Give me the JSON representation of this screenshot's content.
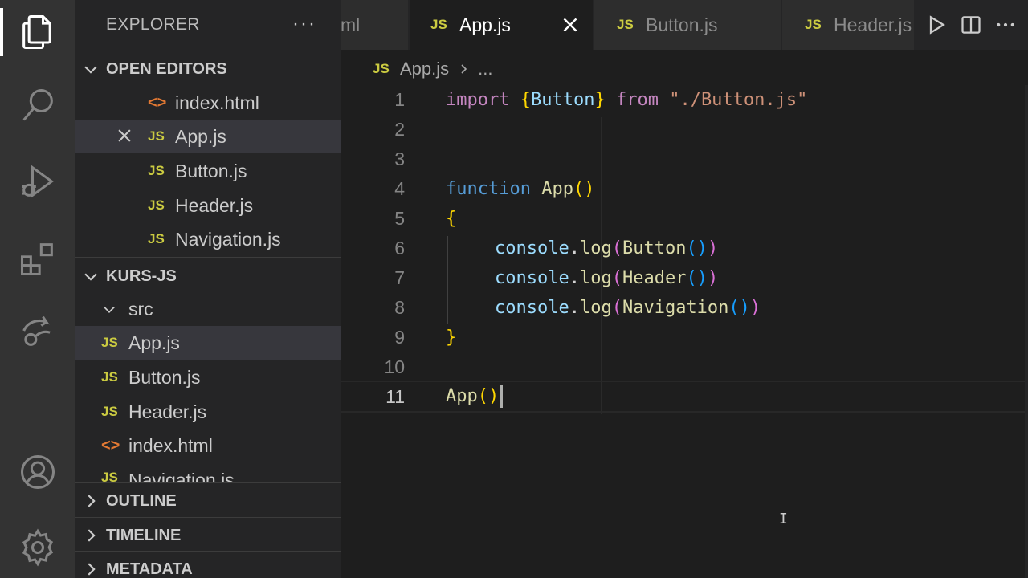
{
  "activity_bar": {
    "items": [
      {
        "name": "explorer",
        "icon": "files-icon"
      },
      {
        "name": "search",
        "icon": "search-icon"
      },
      {
        "name": "run-debug",
        "icon": "debug-icon"
      },
      {
        "name": "extensions",
        "icon": "extensions-icon"
      },
      {
        "name": "remote-explorer",
        "icon": "remote-icon"
      },
      {
        "name": "accounts",
        "icon": "account-icon"
      },
      {
        "name": "manage",
        "icon": "gear-icon"
      }
    ]
  },
  "sidebar": {
    "title": "EXPLORER",
    "more": "···",
    "open_editors": {
      "label": "OPEN EDITORS",
      "items": [
        {
          "badge": "<>",
          "name": "index.html"
        },
        {
          "badge": "JS",
          "name": "App.js"
        },
        {
          "badge": "JS",
          "name": "Button.js"
        },
        {
          "badge": "JS",
          "name": "Header.js"
        },
        {
          "badge": "JS",
          "name": "Navigation.js"
        }
      ]
    },
    "project": {
      "label": "KURS-JS",
      "folder": "src",
      "items": [
        {
          "badge": "JS",
          "name": "App.js"
        },
        {
          "badge": "JS",
          "name": "Button.js"
        },
        {
          "badge": "JS",
          "name": "Header.js"
        },
        {
          "badge": "<>",
          "name": "index.html"
        },
        {
          "badge": "JS",
          "name": "Navigation.js"
        }
      ]
    },
    "outline": "OUTLINE",
    "timeline": "TIMELINE",
    "metadata": "METADATA"
  },
  "tabs": [
    {
      "badge": "",
      "name": "ml"
    },
    {
      "badge": "JS",
      "name": "App.js"
    },
    {
      "badge": "JS",
      "name": "Button.js"
    },
    {
      "badge": "JS",
      "name": "Header.js"
    }
  ],
  "breadcrumb": {
    "badge": "JS",
    "file": "App.js",
    "rest": "..."
  },
  "editor": {
    "line_numbers": [
      "1",
      "2",
      "3",
      "4",
      "5",
      "6",
      "7",
      "8",
      "9",
      "10",
      "11"
    ],
    "lines": {
      "l1": {
        "kw1": "import",
        "open": "{",
        "name": "Button",
        "close": "}",
        "kw2": "from",
        "str": "\"./Button.js\""
      },
      "l4": {
        "kw": "function",
        "fn": "App",
        "parens": "()"
      },
      "l5": {
        "brace": "{"
      },
      "l6": {
        "obj": "console",
        "dot": ".",
        "method": "log",
        "open": "(",
        "call": "Button",
        "inner": "()",
        "close": ")"
      },
      "l7": {
        "obj": "console",
        "dot": ".",
        "method": "log",
        "open": "(",
        "call": "Header",
        "inner": "()",
        "close": ")"
      },
      "l8": {
        "obj": "console",
        "dot": ".",
        "method": "log",
        "open": "(",
        "call": "Navigation",
        "inner": "()",
        "close": ")"
      },
      "l9": {
        "brace": "}"
      },
      "l11": {
        "fn": "App",
        "parens": "()"
      }
    }
  },
  "colors": {
    "activity_bg": "#333333",
    "sidebar_bg": "#252526",
    "editor_bg": "#1e1e1e",
    "js_badge": "#cbcb41",
    "html_badge": "#e37933",
    "keyword": "#c586c0",
    "function_keyword": "#569cd6",
    "function": "#dcdcaa",
    "variable": "#9cdcfe",
    "string": "#ce9178"
  }
}
